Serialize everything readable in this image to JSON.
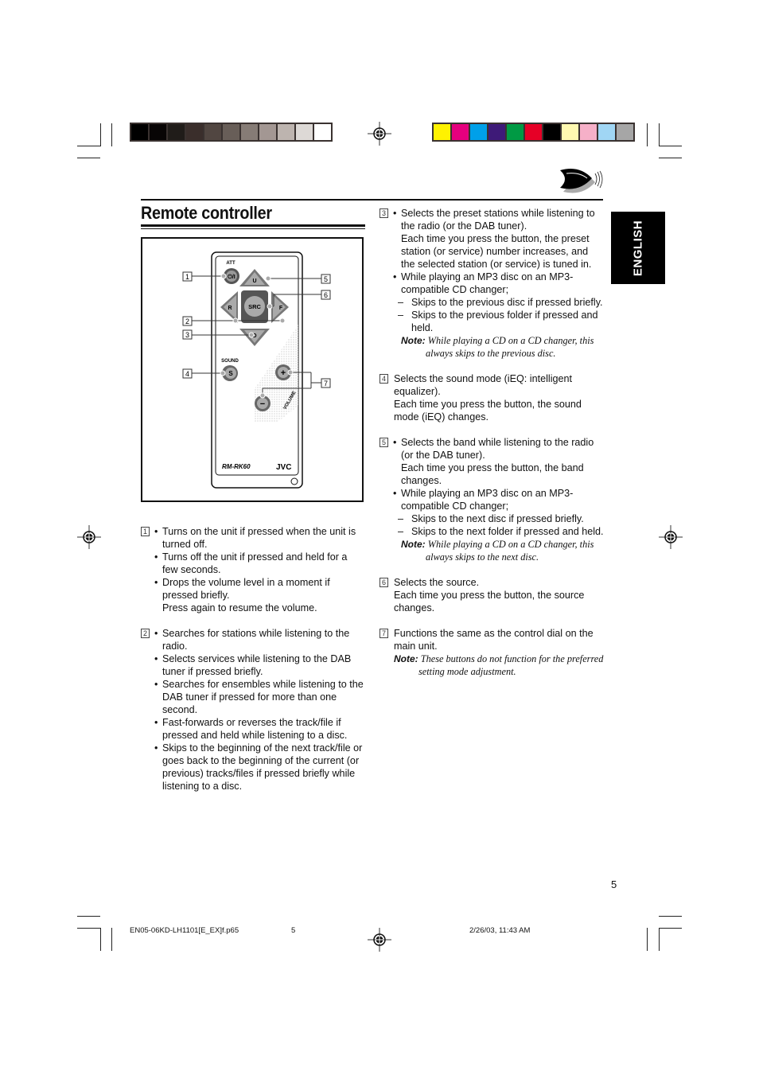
{
  "page": {
    "title": "Remote controller",
    "language_tab": "ENGLISH",
    "page_number": "5",
    "footer": {
      "filename": "EN05-06KD-LH1101[E_EX]f.p65",
      "page": "5",
      "timestamp": "2/26/03, 11:43 AM"
    },
    "icons": {
      "header_icon": "disc-arrow-icon",
      "registration_mark": "crosshair-registration-icon"
    }
  },
  "color_bars": {
    "grayscale": [
      "#000000",
      "#080505",
      "#201c19",
      "#3a2e2b",
      "#514641",
      "#685e58",
      "#867c76",
      "#a39793",
      "#bdb4af",
      "#ddd9d6",
      "#ffffff"
    ],
    "colors": [
      "#fff200",
      "#e6007e",
      "#00a0e9",
      "#3e1a78",
      "#009a44",
      "#e60026",
      "#000000",
      "#fff9b1",
      "#f6b0c8",
      "#a0d6f4",
      "#a6a6a6"
    ]
  },
  "figure": {
    "labels": {
      "att": "ATT",
      "power": "⏻/I",
      "u": "U",
      "r": "R",
      "src": "SRC",
      "f": "F",
      "d": "D",
      "sound": "SOUND",
      "s": "S",
      "plus": "+",
      "minus": "−",
      "volume": "VOLUME",
      "model": "RM-RK60",
      "brand": "JVC"
    },
    "callouts": [
      "1",
      "2",
      "3",
      "4",
      "5",
      "6",
      "7"
    ]
  },
  "items": [
    {
      "num": "1",
      "bullets": [
        "Turns on the unit if pressed when the unit is turned off.",
        "Turns off the unit if pressed and held for a few seconds.",
        "Drops the volume level in a moment if pressed briefly."
      ],
      "extra": "Press again to resume the volume."
    },
    {
      "num": "2",
      "bullets": [
        "Searches for stations while listening to the radio.",
        "Selects services while listening to the DAB tuner if pressed briefly.",
        "Searches for ensembles while listening to the DAB tuner if pressed for more than one second.",
        "Fast-forwards or reverses the track/file if pressed and held while listening to a disc.",
        "Skips to the beginning of the next track/file or goes back to the beginning of the current (or previous) tracks/files if pressed briefly while listening to a disc."
      ]
    },
    {
      "num": "3",
      "bullet1": "Selects the preset stations while listening to the radio (or the DAB tuner).",
      "bullet1_extra": "Each time you press the button, the preset station (or service) number increases, and the selected station (or service) is tuned in.",
      "bullet2": "While playing an MP3 disc on an MP3-compatible CD changer;",
      "dashes": [
        "Skips to the previous disc if pressed briefly.",
        "Skips to the previous folder if pressed and held."
      ],
      "note_label": "Note:",
      "note": "While playing a CD on a CD changer, this always skips to the previous disc."
    },
    {
      "num": "4",
      "text": "Selects the sound mode (iEQ: intelligent equalizer).",
      "extra": "Each time you press the button, the sound mode (iEQ) changes."
    },
    {
      "num": "5",
      "bullet1": "Selects the band while listening to the radio (or the DAB tuner).",
      "bullet1_extra": "Each time you press the button, the band changes.",
      "bullet2": "While playing an MP3 disc on an MP3-compatible CD changer;",
      "dashes": [
        "Skips to the next disc if pressed briefly.",
        "Skips to the next folder if pressed and held."
      ],
      "note_label": "Note:",
      "note": "While playing a CD on a CD changer, this always skips to the next disc."
    },
    {
      "num": "6",
      "text": "Selects the source.",
      "extra": "Each time you press the button, the source changes."
    },
    {
      "num": "7",
      "text": "Functions the same as the control dial on the main unit.",
      "note_label": "Note:",
      "note": "These buttons do not function for the preferred setting mode adjustment."
    }
  ]
}
